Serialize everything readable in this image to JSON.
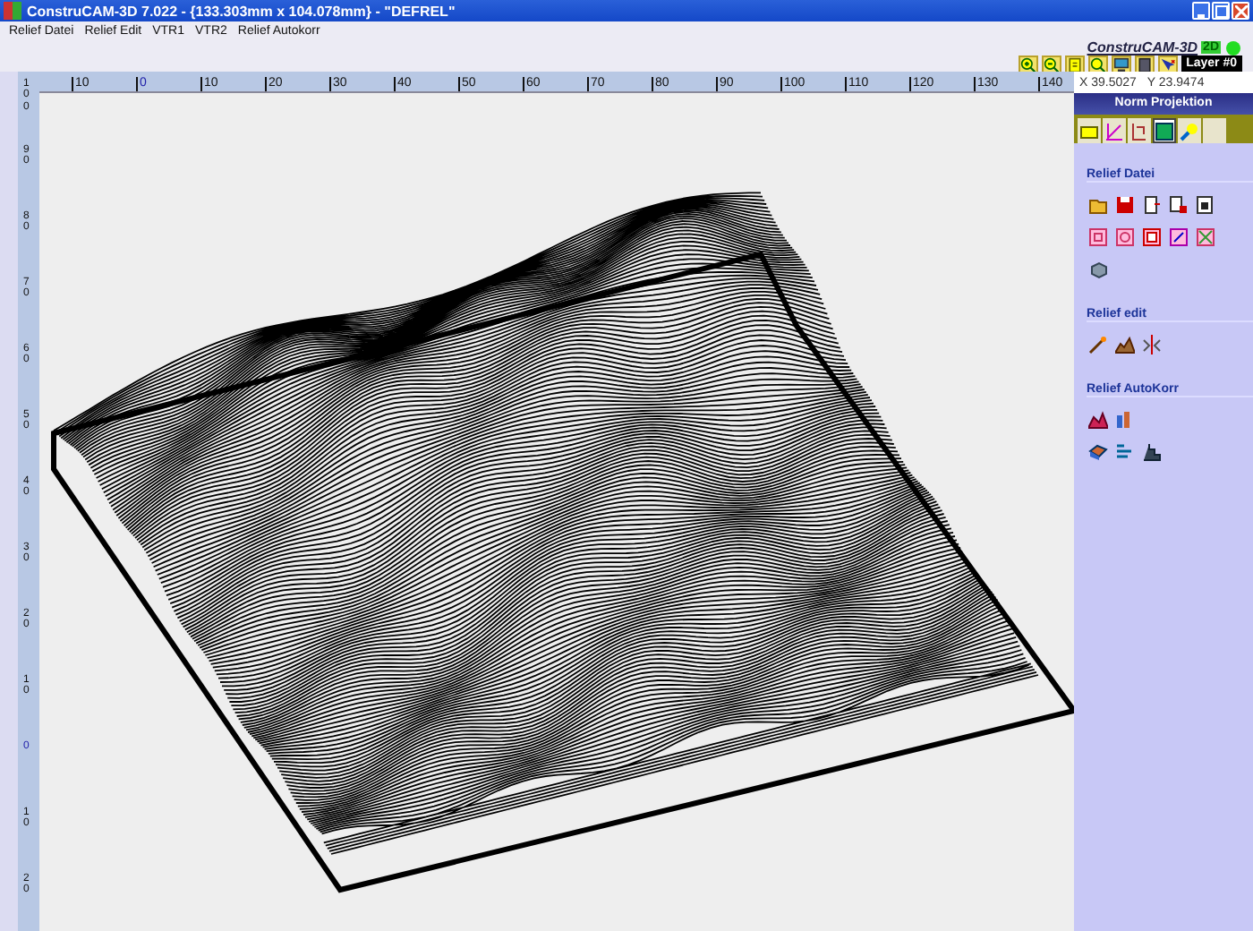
{
  "window": {
    "title": "ConstruCAM-3D 7.022 - {133.303mm x 104.078mm} - \"DEFREL\""
  },
  "menu": [
    "Relief Datei",
    "Relief Edit",
    "VTR1",
    "VTR2",
    "Relief Autokorr"
  ],
  "brand": {
    "logo": "ConstruCAM-3D",
    "mode": "2D"
  },
  "layer": "Layer #0",
  "coordinates": {
    "x": "X 39.5027",
    "y": "Y 23.9474"
  },
  "ruler_top": [
    {
      "label": "10",
      "origin": false
    },
    {
      "label": "0",
      "origin": true
    },
    {
      "label": "10",
      "origin": false
    },
    {
      "label": "20",
      "origin": false
    },
    {
      "label": "30",
      "origin": false
    },
    {
      "label": "40",
      "origin": false
    },
    {
      "label": "50",
      "origin": false
    },
    {
      "label": "60",
      "origin": false
    },
    {
      "label": "70",
      "origin": false
    },
    {
      "label": "80",
      "origin": false
    },
    {
      "label": "90",
      "origin": false
    },
    {
      "label": "100",
      "origin": false
    },
    {
      "label": "110",
      "origin": false
    },
    {
      "label": "120",
      "origin": false
    },
    {
      "label": "130",
      "origin": false
    },
    {
      "label": "140",
      "origin": false
    }
  ],
  "ruler_left": [
    {
      "label": "100",
      "origin": false
    },
    {
      "label": "90",
      "origin": false
    },
    {
      "label": "80",
      "origin": false
    },
    {
      "label": "70",
      "origin": false
    },
    {
      "label": "60",
      "origin": false
    },
    {
      "label": "50",
      "origin": false
    },
    {
      "label": "40",
      "origin": false
    },
    {
      "label": "30",
      "origin": false
    },
    {
      "label": "20",
      "origin": false
    },
    {
      "label": "10",
      "origin": false
    },
    {
      "label": "0",
      "origin": true
    },
    {
      "label": "10",
      "origin": false
    },
    {
      "label": "20",
      "origin": false
    }
  ],
  "panel": {
    "title": "Norm Projektion",
    "tabs": [
      {
        "selected": false
      },
      {
        "selected": false
      },
      {
        "selected": false
      },
      {
        "selected": true
      },
      {
        "selected": false
      },
      {
        "selected": false
      }
    ],
    "sections": [
      {
        "title": "Relief Datei"
      },
      {
        "title": "Relief edit"
      },
      {
        "title": "Relief AutoKorr"
      }
    ]
  }
}
